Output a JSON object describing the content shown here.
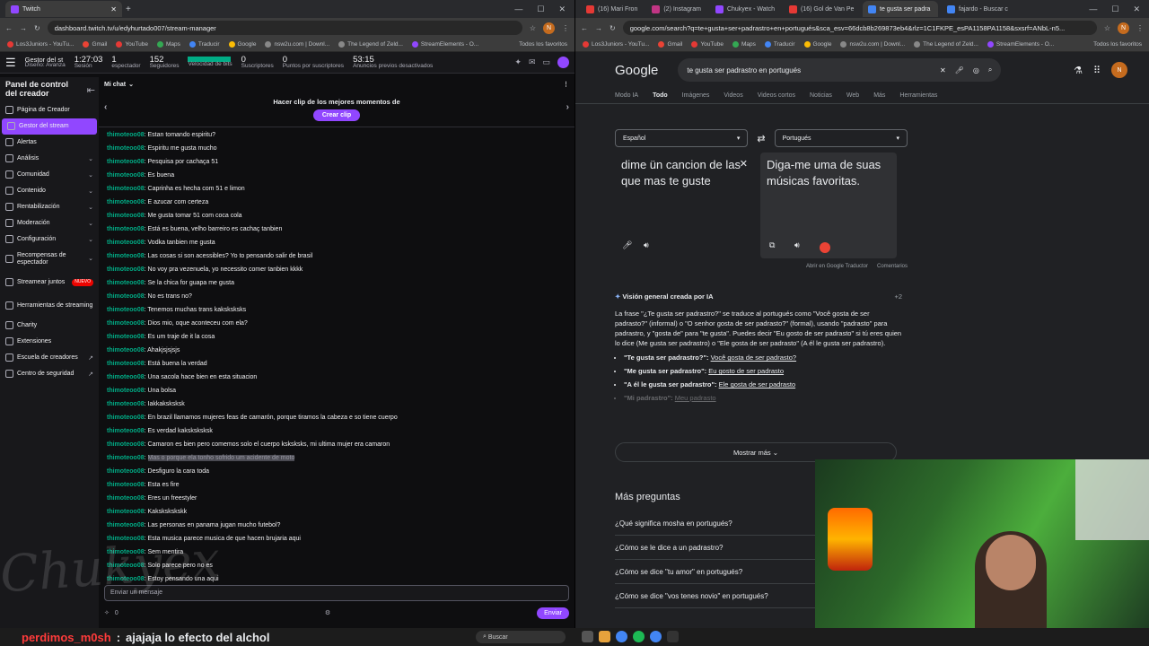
{
  "left_browser": {
    "tab_title": "Twitch",
    "url": "dashboard.twitch.tv/u/edyhurtado007/stream-manager",
    "bookmarks": [
      "Los3Juniors - YouTu...",
      "Gmail",
      "YouTube",
      "Maps",
      "Traducir",
      "Google",
      "nsw2u.com | Downl...",
      "The Legend of Zeld...",
      "StreamElements - O..."
    ],
    "bookmarks_right": "Todos los favoritos",
    "avatar_letter": "N"
  },
  "twitch": {
    "manager": "Gestor del st",
    "layout": "Diseño: Avanza",
    "session_time": "1:27:03",
    "session_label": "Sesión",
    "viewers": "1",
    "viewers_label": "espectador",
    "followers": "152",
    "followers_label": "Seguidores",
    "bitrate_label": "Velocidad de bits",
    "subs": "0",
    "subs_label": "Suscriptores",
    "points": "0",
    "points_label": "Puntos por suscriptores",
    "ads": "53:15",
    "ads_label": "Anuncios previos desactivados",
    "sidebar_title": "Panel de control del creador",
    "nav": [
      {
        "label": "Página de Creador"
      },
      {
        "label": "Gestor del stream"
      },
      {
        "label": "Alertas"
      },
      {
        "label": "Análisis"
      },
      {
        "label": "Comunidad"
      },
      {
        "label": "Contenido"
      },
      {
        "label": "Rentabilización"
      },
      {
        "label": "Moderación"
      },
      {
        "label": "Configuración"
      },
      {
        "label": "Recompensas de espectador"
      },
      {
        "label": "Streamear juntos"
      },
      {
        "label": "Herramientas de streaming"
      },
      {
        "label": "Charity"
      },
      {
        "label": "Extensiones"
      },
      {
        "label": "Escuela de creadores"
      },
      {
        "label": "Centro de seguridad"
      }
    ],
    "new_badge": "NUEVO",
    "chat_title": "Mi chat",
    "clip_heading": "Hacer clip de los mejores momentos de",
    "clip_button": "Crear clip",
    "messages": [
      {
        "user": "thimoteoo08",
        "text": "Estan tomando espiritu?"
      },
      {
        "user": "thimoteoo08",
        "text": "Espiritu me gusta mucho"
      },
      {
        "user": "thimoteoo08",
        "text": "Pesquisa por cachaça 51"
      },
      {
        "user": "thimoteoo08",
        "text": "Es buena"
      },
      {
        "user": "thimoteoo08",
        "text": "Caprinha es hecha com 51 e limon"
      },
      {
        "user": "thimoteoo08",
        "text": "E azucar com certeza"
      },
      {
        "user": "thimoteoo08",
        "text": "Me gusta tomar 51 com coca cola"
      },
      {
        "user": "thimoteoo08",
        "text": "Está es buena, velho barreiro es cachaç tanbien"
      },
      {
        "user": "thimoteoo08",
        "text": "Vodka tanbien me gusta"
      },
      {
        "user": "thimoteoo08",
        "text": "Las cosas si son acessibles? Yo to pensando salir de brasil"
      },
      {
        "user": "thimoteoo08",
        "text": "No voy pra vezenuela, yo necessito comer tanbien kkkk"
      },
      {
        "user": "thimoteoo08",
        "text": "Se la chica for guapa me gusta"
      },
      {
        "user": "thimoteoo08",
        "text": "No es trans no?"
      },
      {
        "user": "thimoteoo08",
        "text": "Tenemos muchas trans kaksksksks"
      },
      {
        "user": "thimoteoo08",
        "text": "Dios mio, oque aconteceu com ela?"
      },
      {
        "user": "thimoteoo08",
        "text": "Es um traje de it la cosa"
      },
      {
        "user": "thimoteoo08",
        "text": "Ahakjsjsjsjs"
      },
      {
        "user": "thimoteoo08",
        "text": "Está buena la verdad"
      },
      {
        "user": "thimoteoo08",
        "text": "Una sacola hace bien en esta situacion"
      },
      {
        "user": "thimoteoo08",
        "text": "Una bolsa"
      },
      {
        "user": "thimoteoo08",
        "text": "Iakkaksksksk"
      },
      {
        "user": "thimoteoo08",
        "text": "En brazil llamamos mujeres feas de camarón, porque tiramos la cabeza e so tiene cuerpo"
      },
      {
        "user": "thimoteoo08",
        "text": "Es verdad kaksksksksk"
      },
      {
        "user": "thimoteoo08",
        "text": "Camaron es bien pero comemos solo el cuerpo ksksksks, mi ultima mujer era camaron"
      },
      {
        "user": "thimoteoo08",
        "text": "Mas o porque ela tonho sofrido um acidente de moto",
        "highlight": true
      },
      {
        "user": "thimoteoo08",
        "text": "Desfiguro la cara toda"
      },
      {
        "user": "thimoteoo08",
        "text": "Esta es fire"
      },
      {
        "user": "thimoteoo08",
        "text": "Eres un freestyler"
      },
      {
        "user": "thimoteoo08",
        "text": "Kakskskskskk"
      },
      {
        "user": "thimoteoo08",
        "text": "Las personas en panama jugan mucho futebol?"
      },
      {
        "user": "thimoteoo08",
        "text": "Esta musica parece musica de que hacen brujaria aqui"
      },
      {
        "user": "thimoteoo08",
        "text": "Sem mentira"
      },
      {
        "user": "thimoteoo08",
        "text": "Solo parece pero no es"
      },
      {
        "user": "thimoteoo08",
        "text": "Estoy pensando una aqui"
      }
    ],
    "chat_placeholder": "Enviar un mensaje",
    "points_count": "0",
    "send_button": "Enviar",
    "watermark": "Chukyex"
  },
  "right_browser": {
    "tabs": [
      "(16) Mari Fron",
      "(2) Instagram",
      "Chukyex - Watch",
      "(16) Gol de Van Pe",
      "te gusta ser padra",
      "fajardo - Buscar c"
    ],
    "url": "google.com/search?q=te+gusta+ser+padrastro+en+portugués&sca_esv=66dcb8b269873eb4&rlz=1C1FKPE_esPA1158PA1158&sxsrf=ANbL-n5...",
    "bookmarks": [
      "Los3Juniors - YouTu...",
      "Gmail",
      "YouTube",
      "Maps",
      "Traducir",
      "Google",
      "nsw2u.com | Downl...",
      "The Legend of Zeld...",
      "StreamElements - O..."
    ],
    "bookmarks_right": "Todos los favoritos"
  },
  "google": {
    "logo": "Google",
    "query": "te gusta ser padrastro en portugués",
    "nav": [
      "Modo IA",
      "Todo",
      "Imágenes",
      "Videos",
      "Videos cortos",
      "Noticias",
      "Web",
      "Más",
      "Herramientas"
    ],
    "src_lang": "Español",
    "dst_lang": "Portugués",
    "src_text": "dime ün cancion de las que mas te guste",
    "dst_text": "Diga-me uma de suas músicas favoritas.",
    "open_translate": "Abrir en Google Traductor",
    "comments": "Comentarios",
    "ai_title": "Visión general creada por IA",
    "ai_count": "+2",
    "ai_text": "La frase \"¿Te gusta ser padrastro?\" se traduce al portugués como \"Você gosta de ser padrasto?\" (informal) o \"O senhor gosta de ser padrasto?\" (formal), usando \"padrasto\" para padrastro, y \"gosta de\" para \"te gusta\". Puedes decir \"Eu gosto de ser padrasto\" si tú eres quien lo dice (Me gusta ser padrastro) o \"Ele gosta de ser padrasto\" (A él le gusta ser padrastro).",
    "ai_bullets": [
      {
        "q": "\"Te gusta ser padrastro?\":",
        "a": "Você gosta de ser padrasto?"
      },
      {
        "q": "\"Me gusta ser padrastro\":",
        "a": "Eu gosto de ser padrasto"
      },
      {
        "q": "\"A él le gusta ser padrastro\":",
        "a": "Ele gosta de ser padrasto"
      },
      {
        "q": "\"Mi padrastro\":",
        "a": "Meu padrasto"
      }
    ],
    "show_more": "Mostrar más",
    "paa_title": "Más preguntas",
    "paa": [
      "¿Qué significa mosha en portugués?",
      "¿Cómo se le dice a un padrastro?",
      "¿Cómo se dice \"tu amor\" en portugués?",
      "¿Cómo se dice \"vos tenes novio\" en portugués?"
    ]
  },
  "taskbar": {
    "alert_user": "perdimos_m0sh",
    "alert_text": "ajajaja lo efecto del alchol",
    "search": "Buscar"
  },
  "colors": {
    "twitch_purple": "#9147ff",
    "chat_user": "#00ad86"
  }
}
